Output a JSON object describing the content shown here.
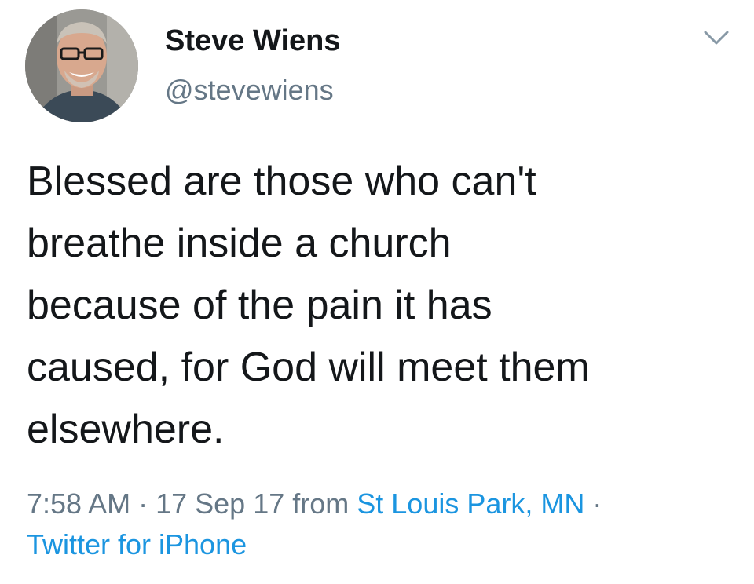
{
  "tweet": {
    "author": {
      "name": "Steve Wiens",
      "handle": "@stevewiens",
      "avatar_icon": "user-avatar-photo"
    },
    "menu_icon": "chevron-down-icon",
    "text": "Blessed are those who can't\nbreathe inside a church\nbecause of the pain it has\ncaused, for God will meet them\nelsewhere.",
    "meta": {
      "time": "7:58 AM",
      "separator": " · ",
      "date": "17 Sep 17",
      "from_label": " from ",
      "location": "St Louis Park, MN",
      "separator2": " · ",
      "source": "Twitter for iPhone"
    }
  },
  "colors": {
    "text": "#14171a",
    "secondary": "#657786",
    "link": "#1b95e0",
    "background": "#ffffff"
  }
}
